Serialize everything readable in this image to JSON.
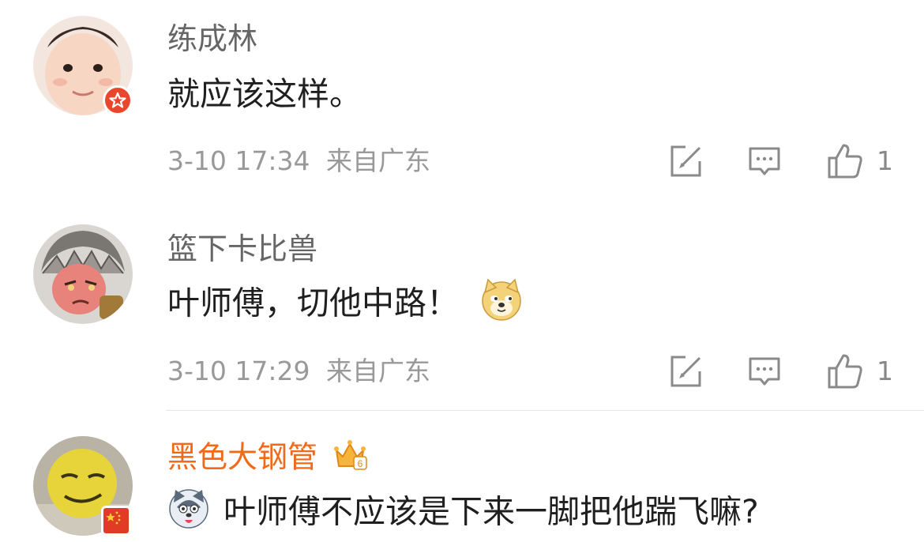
{
  "comments": [
    {
      "username": "练成林",
      "text": "就应该这样。",
      "timestamp": "3-10 17:34",
      "source": "来自广东",
      "likes": "1",
      "badge_icon": "star-badge-icon"
    },
    {
      "username": "篮下卡比兽",
      "text": "叶师傅，切他中路！",
      "timestamp": "3-10 17:29",
      "source": "来自广东",
      "likes": "1",
      "emoji_icon": "doge-emoji-icon"
    },
    {
      "username": "黑色大钢管",
      "text": "叶师傅不应该是下来一脚把他踹飞嘛?",
      "username_color": "#f26a19",
      "emoji_icon": "husky-emoji-icon",
      "badge_icon": "china-flag-badge-icon",
      "level_badge": "6"
    }
  ],
  "colors": {
    "text": "#1f1f1f",
    "username": "#666666",
    "vip_username": "#f26a19",
    "meta": "#999999",
    "divider": "#e6e6e6"
  }
}
